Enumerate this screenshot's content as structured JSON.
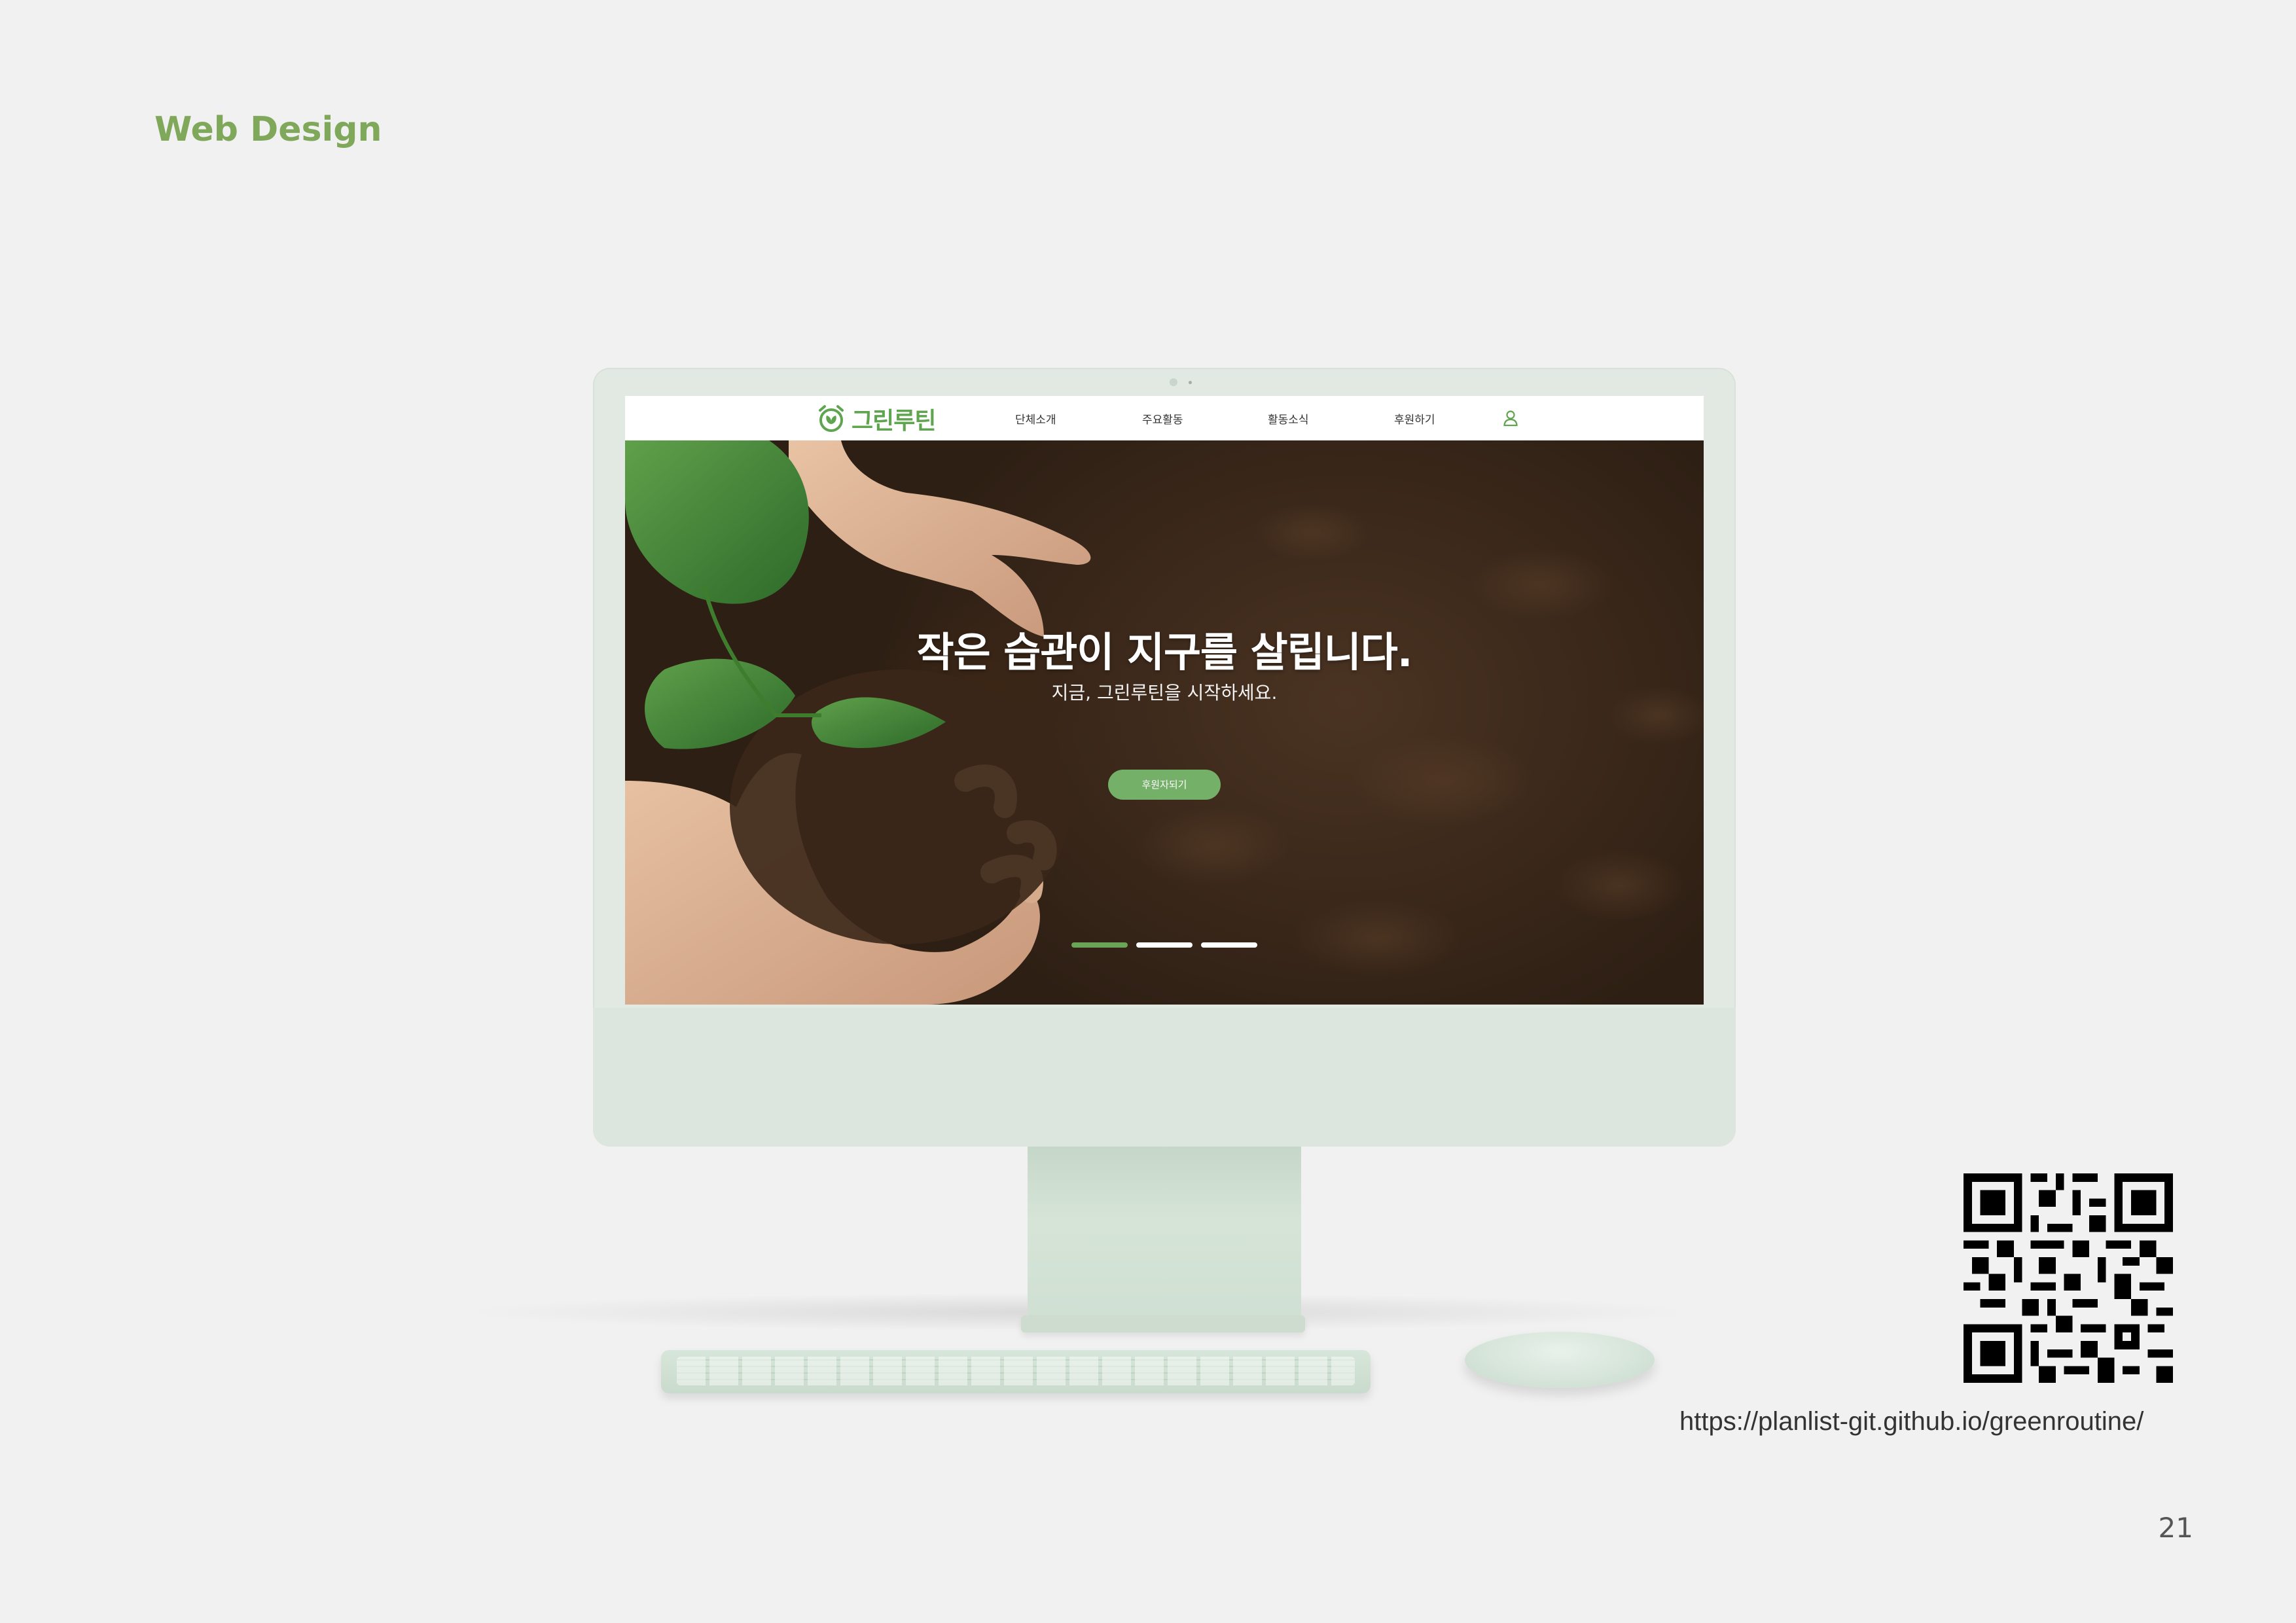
{
  "slide": {
    "title": "Web Design",
    "page_number": "21",
    "url": "https://planlist-git.github.io/greenroutine/"
  },
  "site": {
    "logo_text": "그린루틴",
    "nav": [
      {
        "label": "단체소개"
      },
      {
        "label": "주요활동"
      },
      {
        "label": "활동소식"
      },
      {
        "label": "후원하기"
      }
    ],
    "user_icon": "user-icon",
    "hero": {
      "title": "작은 습관이 지구를 살립니다.",
      "subtitle": "지금, 그린루틴을 시작하세요.",
      "button_label": "후원자되기",
      "slides": {
        "count": 3,
        "active_index": 0
      }
    }
  },
  "colors": {
    "accent_green": "#6aa456",
    "title_green": "#7fa85a",
    "background": "#f1f1f1",
    "device_mint": "#e1e9e2"
  }
}
